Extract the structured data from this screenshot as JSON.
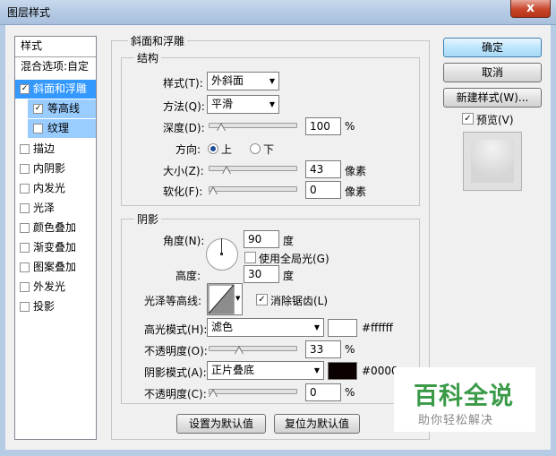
{
  "window": {
    "title": "图层样式",
    "close_label": "x"
  },
  "styles_list": {
    "header": "样式",
    "blend_options": "混合选项:自定",
    "items": [
      {
        "label": "斜面和浮雕",
        "checked": true
      },
      {
        "label": "等高线",
        "checked": true
      },
      {
        "label": "纹理",
        "checked": false
      },
      {
        "label": "描边",
        "checked": false
      },
      {
        "label": "内阴影",
        "checked": false
      },
      {
        "label": "内发光",
        "checked": false
      },
      {
        "label": "光泽",
        "checked": false
      },
      {
        "label": "颜色叠加",
        "checked": false
      },
      {
        "label": "渐变叠加",
        "checked": false
      },
      {
        "label": "图案叠加",
        "checked": false
      },
      {
        "label": "外发光",
        "checked": false
      },
      {
        "label": "投影",
        "checked": false
      }
    ]
  },
  "bevel": {
    "group_title": "斜面和浮雕",
    "structure_title": "结构",
    "style_label": "样式(T):",
    "style_value": "外斜面",
    "technique_label": "方法(Q):",
    "technique_value": "平滑",
    "depth_label": "深度(D):",
    "depth_value": "100",
    "depth_unit": "%",
    "depth_level": 0.1,
    "direction_label": "方向:",
    "direction_up": "上",
    "direction_down": "下",
    "size_label": "大小(Z):",
    "size_value": "43",
    "size_unit": "像素",
    "size_level": 0.17,
    "soften_label": "软化(F):",
    "soften_value": "0",
    "soften_unit": "像素",
    "soften_level": 0.0
  },
  "shading": {
    "title": "阴影",
    "angle_label": "角度(N):",
    "angle_value": "90",
    "angle_unit": "度",
    "global_light_label": "使用全局光(G)",
    "altitude_label": "高度:",
    "altitude_value": "30",
    "altitude_unit": "度",
    "gloss_label": "光泽等高线:",
    "antialias_label": "消除锯齿(L)",
    "highlight_mode_label": "高光模式(H):",
    "highlight_mode_value": "滤色",
    "highlight_color": "#ffffff",
    "highlight_hex": "#ffffff",
    "highlight_opacity_label": "不透明度(O):",
    "highlight_opacity_value": "33",
    "highlight_opacity_level": 0.33,
    "shadow_mode_label": "阴影模式(A):",
    "shadow_mode_value": "正片叠底",
    "shadow_color": "#0a0000",
    "shadow_hex": "#0000",
    "shadow_opacity_label": "不透明度(C):",
    "shadow_opacity_value": "0",
    "shadow_opacity_level": 0.0,
    "percent": "%"
  },
  "footer": {
    "make_default": "设置为默认值",
    "reset_default": "复位为默认值"
  },
  "side_buttons": {
    "ok": "确定",
    "cancel": "取消",
    "new_style": "新建样式(W)...",
    "preview_label": "预览(V)"
  },
  "watermark": {
    "main": "百科全说",
    "sub": "助你轻松解决"
  }
}
